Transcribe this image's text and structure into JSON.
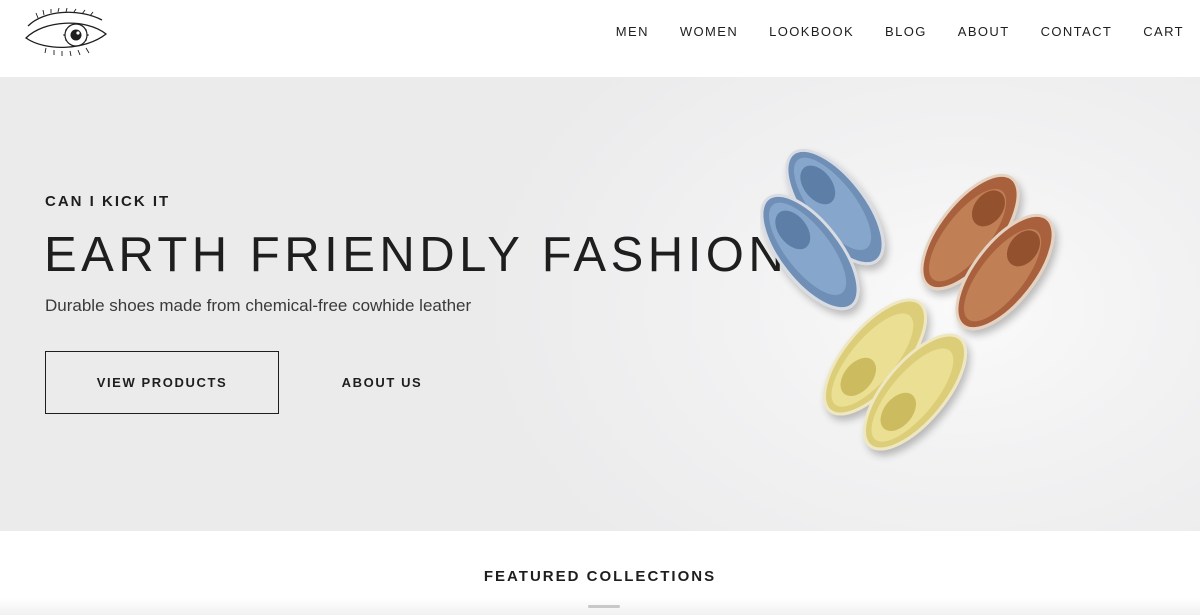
{
  "header": {
    "logo_icon": "eye-logo-icon",
    "nav": [
      {
        "label": "MEN"
      },
      {
        "label": "WOMEN"
      },
      {
        "label": "LOOKBOOK"
      },
      {
        "label": "BLOG"
      },
      {
        "label": "ABOUT"
      },
      {
        "label": "CONTACT"
      },
      {
        "label": "CART"
      }
    ]
  },
  "hero": {
    "eyebrow": "CAN I KICK IT",
    "headline": "EARTH FRIENDLY FASHION",
    "subhead": "Durable shoes made from chemical-free cowhide leather",
    "primary_button": "VIEW PRODUCTS",
    "secondary_button": "ABOUT US",
    "image": "colored-leather-shoes-photo",
    "shoe_colors": {
      "blue": "#7f9fc4",
      "brown": "#b9764f",
      "yellow": "#e6d98a"
    }
  },
  "featured": {
    "title": "FEATURED COLLECTIONS"
  }
}
